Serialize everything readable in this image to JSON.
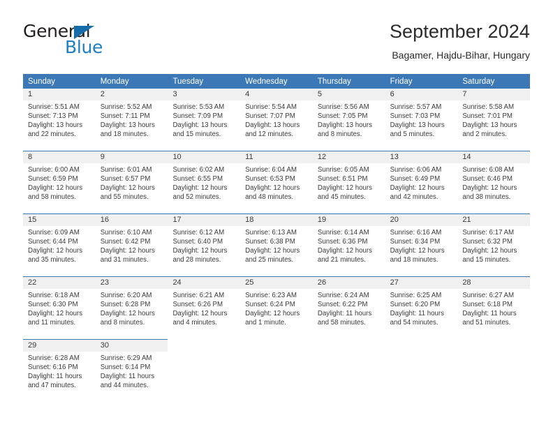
{
  "brand": {
    "name_top": "General",
    "name_bottom": "Blue",
    "triangle_icon": "triangle-icon",
    "color_dark": "#231f20",
    "color_blue": "#1d7fc4"
  },
  "header": {
    "title": "September 2024",
    "subtitle": "Bagamer, Hajdu-Bihar, Hungary"
  },
  "calendar": {
    "header_bg": "#3b78b5",
    "daynum_bg": "#f0f0f0",
    "weekdays": [
      "Sunday",
      "Monday",
      "Tuesday",
      "Wednesday",
      "Thursday",
      "Friday",
      "Saturday"
    ],
    "weeks": [
      [
        {
          "day": "1",
          "sunrise": "Sunrise: 5:51 AM",
          "sunset": "Sunset: 7:13 PM",
          "daylight_1": "Daylight: 13 hours",
          "daylight_2": "and 22 minutes."
        },
        {
          "day": "2",
          "sunrise": "Sunrise: 5:52 AM",
          "sunset": "Sunset: 7:11 PM",
          "daylight_1": "Daylight: 13 hours",
          "daylight_2": "and 18 minutes."
        },
        {
          "day": "3",
          "sunrise": "Sunrise: 5:53 AM",
          "sunset": "Sunset: 7:09 PM",
          "daylight_1": "Daylight: 13 hours",
          "daylight_2": "and 15 minutes."
        },
        {
          "day": "4",
          "sunrise": "Sunrise: 5:54 AM",
          "sunset": "Sunset: 7:07 PM",
          "daylight_1": "Daylight: 13 hours",
          "daylight_2": "and 12 minutes."
        },
        {
          "day": "5",
          "sunrise": "Sunrise: 5:56 AM",
          "sunset": "Sunset: 7:05 PM",
          "daylight_1": "Daylight: 13 hours",
          "daylight_2": "and 8 minutes."
        },
        {
          "day": "6",
          "sunrise": "Sunrise: 5:57 AM",
          "sunset": "Sunset: 7:03 PM",
          "daylight_1": "Daylight: 13 hours",
          "daylight_2": "and 5 minutes."
        },
        {
          "day": "7",
          "sunrise": "Sunrise: 5:58 AM",
          "sunset": "Sunset: 7:01 PM",
          "daylight_1": "Daylight: 13 hours",
          "daylight_2": "and 2 minutes."
        }
      ],
      [
        {
          "day": "8",
          "sunrise": "Sunrise: 6:00 AM",
          "sunset": "Sunset: 6:59 PM",
          "daylight_1": "Daylight: 12 hours",
          "daylight_2": "and 58 minutes."
        },
        {
          "day": "9",
          "sunrise": "Sunrise: 6:01 AM",
          "sunset": "Sunset: 6:57 PM",
          "daylight_1": "Daylight: 12 hours",
          "daylight_2": "and 55 minutes."
        },
        {
          "day": "10",
          "sunrise": "Sunrise: 6:02 AM",
          "sunset": "Sunset: 6:55 PM",
          "daylight_1": "Daylight: 12 hours",
          "daylight_2": "and 52 minutes."
        },
        {
          "day": "11",
          "sunrise": "Sunrise: 6:04 AM",
          "sunset": "Sunset: 6:53 PM",
          "daylight_1": "Daylight: 12 hours",
          "daylight_2": "and 48 minutes."
        },
        {
          "day": "12",
          "sunrise": "Sunrise: 6:05 AM",
          "sunset": "Sunset: 6:51 PM",
          "daylight_1": "Daylight: 12 hours",
          "daylight_2": "and 45 minutes."
        },
        {
          "day": "13",
          "sunrise": "Sunrise: 6:06 AM",
          "sunset": "Sunset: 6:49 PM",
          "daylight_1": "Daylight: 12 hours",
          "daylight_2": "and 42 minutes."
        },
        {
          "day": "14",
          "sunrise": "Sunrise: 6:08 AM",
          "sunset": "Sunset: 6:46 PM",
          "daylight_1": "Daylight: 12 hours",
          "daylight_2": "and 38 minutes."
        }
      ],
      [
        {
          "day": "15",
          "sunrise": "Sunrise: 6:09 AM",
          "sunset": "Sunset: 6:44 PM",
          "daylight_1": "Daylight: 12 hours",
          "daylight_2": "and 35 minutes."
        },
        {
          "day": "16",
          "sunrise": "Sunrise: 6:10 AM",
          "sunset": "Sunset: 6:42 PM",
          "daylight_1": "Daylight: 12 hours",
          "daylight_2": "and 31 minutes."
        },
        {
          "day": "17",
          "sunrise": "Sunrise: 6:12 AM",
          "sunset": "Sunset: 6:40 PM",
          "daylight_1": "Daylight: 12 hours",
          "daylight_2": "and 28 minutes."
        },
        {
          "day": "18",
          "sunrise": "Sunrise: 6:13 AM",
          "sunset": "Sunset: 6:38 PM",
          "daylight_1": "Daylight: 12 hours",
          "daylight_2": "and 25 minutes."
        },
        {
          "day": "19",
          "sunrise": "Sunrise: 6:14 AM",
          "sunset": "Sunset: 6:36 PM",
          "daylight_1": "Daylight: 12 hours",
          "daylight_2": "and 21 minutes."
        },
        {
          "day": "20",
          "sunrise": "Sunrise: 6:16 AM",
          "sunset": "Sunset: 6:34 PM",
          "daylight_1": "Daylight: 12 hours",
          "daylight_2": "and 18 minutes."
        },
        {
          "day": "21",
          "sunrise": "Sunrise: 6:17 AM",
          "sunset": "Sunset: 6:32 PM",
          "daylight_1": "Daylight: 12 hours",
          "daylight_2": "and 15 minutes."
        }
      ],
      [
        {
          "day": "22",
          "sunrise": "Sunrise: 6:18 AM",
          "sunset": "Sunset: 6:30 PM",
          "daylight_1": "Daylight: 12 hours",
          "daylight_2": "and 11 minutes."
        },
        {
          "day": "23",
          "sunrise": "Sunrise: 6:20 AM",
          "sunset": "Sunset: 6:28 PM",
          "daylight_1": "Daylight: 12 hours",
          "daylight_2": "and 8 minutes."
        },
        {
          "day": "24",
          "sunrise": "Sunrise: 6:21 AM",
          "sunset": "Sunset: 6:26 PM",
          "daylight_1": "Daylight: 12 hours",
          "daylight_2": "and 4 minutes."
        },
        {
          "day": "25",
          "sunrise": "Sunrise: 6:23 AM",
          "sunset": "Sunset: 6:24 PM",
          "daylight_1": "Daylight: 12 hours",
          "daylight_2": "and 1 minute."
        },
        {
          "day": "26",
          "sunrise": "Sunrise: 6:24 AM",
          "sunset": "Sunset: 6:22 PM",
          "daylight_1": "Daylight: 11 hours",
          "daylight_2": "and 58 minutes."
        },
        {
          "day": "27",
          "sunrise": "Sunrise: 6:25 AM",
          "sunset": "Sunset: 6:20 PM",
          "daylight_1": "Daylight: 11 hours",
          "daylight_2": "and 54 minutes."
        },
        {
          "day": "28",
          "sunrise": "Sunrise: 6:27 AM",
          "sunset": "Sunset: 6:18 PM",
          "daylight_1": "Daylight: 11 hours",
          "daylight_2": "and 51 minutes."
        }
      ],
      [
        {
          "day": "29",
          "sunrise": "Sunrise: 6:28 AM",
          "sunset": "Sunset: 6:16 PM",
          "daylight_1": "Daylight: 11 hours",
          "daylight_2": "and 47 minutes."
        },
        {
          "day": "30",
          "sunrise": "Sunrise: 6:29 AM",
          "sunset": "Sunset: 6:14 PM",
          "daylight_1": "Daylight: 11 hours",
          "daylight_2": "and 44 minutes."
        },
        {
          "day": "",
          "sunrise": "",
          "sunset": "",
          "daylight_1": "",
          "daylight_2": ""
        },
        {
          "day": "",
          "sunrise": "",
          "sunset": "",
          "daylight_1": "",
          "daylight_2": ""
        },
        {
          "day": "",
          "sunrise": "",
          "sunset": "",
          "daylight_1": "",
          "daylight_2": ""
        },
        {
          "day": "",
          "sunrise": "",
          "sunset": "",
          "daylight_1": "",
          "daylight_2": ""
        },
        {
          "day": "",
          "sunrise": "",
          "sunset": "",
          "daylight_1": "",
          "daylight_2": ""
        }
      ]
    ]
  }
}
